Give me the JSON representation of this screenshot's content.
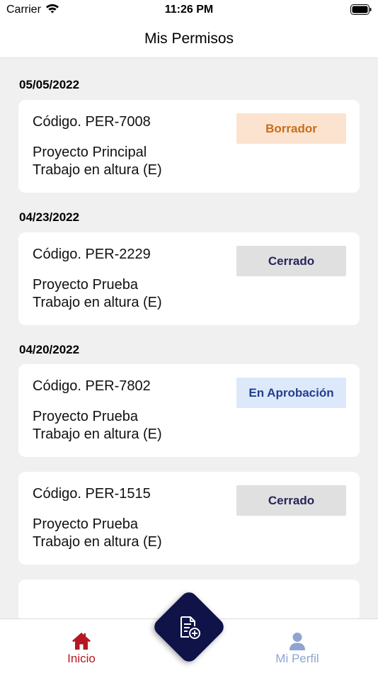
{
  "status_bar": {
    "carrier": "Carrier",
    "time": "11:26 PM"
  },
  "header": {
    "title": "Mis Permisos"
  },
  "groups": [
    {
      "date": "05/05/2022"
    },
    {
      "date": "04/23/2022"
    },
    {
      "date": "04/20/2022"
    }
  ],
  "permits": [
    {
      "code": "Código. PER-7008",
      "project": "Proyecto Principal",
      "type": "Trabajo en altura (E)",
      "status": "Borrador"
    },
    {
      "code": "Código. PER-2229",
      "project": "Proyecto Prueba",
      "type": "Trabajo en altura (E)",
      "status": "Cerrado"
    },
    {
      "code": "Código. PER-7802",
      "project": "Proyecto Prueba",
      "type": "Trabajo en altura (E)",
      "status": "En Aprobación"
    },
    {
      "code": "Código. PER-1515",
      "project": "Proyecto Prueba",
      "type": "Trabajo en altura (E)",
      "status": "Cerrado"
    }
  ],
  "tab_bar": {
    "home_label": "Inicio",
    "profile_label": "Mi Perfil",
    "home_icon": "home-icon",
    "profile_icon": "person-icon",
    "fab_icon": "new-document-icon"
  },
  "colors": {
    "accent_active": "#b51822",
    "tab_inactive": "#8fa4d1",
    "fab_bg": "#0f1347",
    "borrador_bg": "#fbe3cf",
    "borrador_text": "#c76d1c",
    "cerrado_bg": "#e0e0e0",
    "cerrado_text": "#26255a",
    "aprobacion_bg": "#dde9fa",
    "aprobacion_text": "#23408f"
  }
}
